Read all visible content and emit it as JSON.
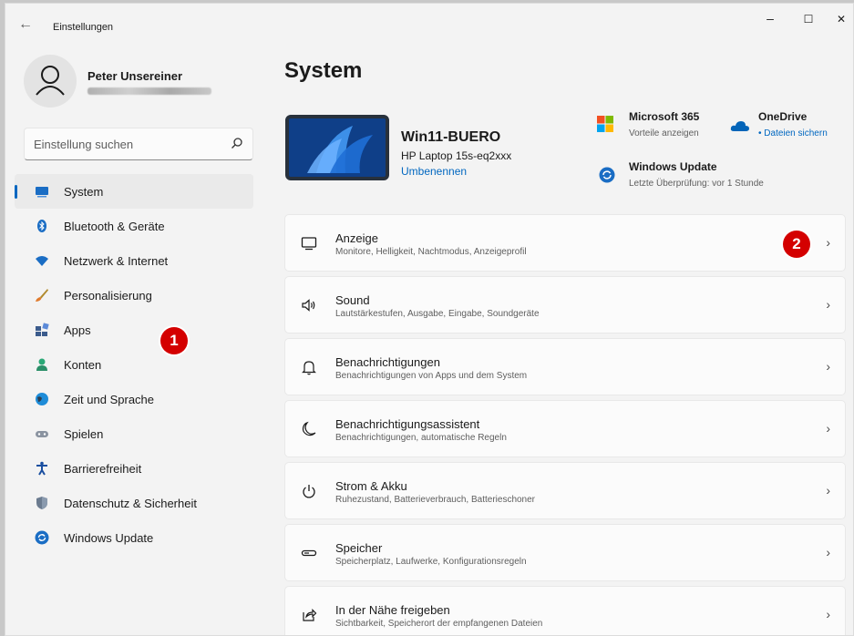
{
  "window": {
    "title": "Einstellungen",
    "back": "←",
    "minimize": "–",
    "maximize": "☐",
    "close": "✕"
  },
  "user": {
    "name": "Peter Unsereiner"
  },
  "search": {
    "placeholder": "Einstellung suchen"
  },
  "nav": [
    {
      "label": "System",
      "icon": "system-icon",
      "active": true
    },
    {
      "label": "Bluetooth & Geräte",
      "icon": "bluetooth-icon"
    },
    {
      "label": "Netzwerk & Internet",
      "icon": "network-icon"
    },
    {
      "label": "Personalisierung",
      "icon": "brush-icon"
    },
    {
      "label": "Apps",
      "icon": "apps-icon"
    },
    {
      "label": "Konten",
      "icon": "account-icon"
    },
    {
      "label": "Zeit und Sprache",
      "icon": "globe-icon"
    },
    {
      "label": "Spielen",
      "icon": "gamepad-icon"
    },
    {
      "label": "Barrierefreiheit",
      "icon": "accessibility-icon"
    },
    {
      "label": "Datenschutz & Sicherheit",
      "icon": "shield-icon"
    },
    {
      "label": "Windows Update",
      "icon": "update-icon"
    }
  ],
  "badges": {
    "one": "1",
    "two": "2"
  },
  "main": {
    "title": "System",
    "device": {
      "name": "Win11-BUERO",
      "model": "HP Laptop 15s-eq2xxx",
      "rename": "Umbenennen"
    },
    "quick": {
      "m365": {
        "title": "Microsoft 365",
        "sub": "Vorteile anzeigen"
      },
      "onedrive": {
        "title": "OneDrive",
        "sub": "• Dateien sichern"
      },
      "update": {
        "title": "Windows Update",
        "sub": "Letzte Überprüfung: vor 1 Stunde"
      }
    },
    "cards": [
      {
        "title": "Anzeige",
        "sub": "Monitore, Helligkeit, Nachtmodus, Anzeigeprofil",
        "icon": "monitor-icon"
      },
      {
        "title": "Sound",
        "sub": "Lautstärkestufen, Ausgabe, Eingabe, Soundgeräte",
        "icon": "speaker-icon"
      },
      {
        "title": "Benachrichtigungen",
        "sub": "Benachrichtigungen von Apps und dem System",
        "icon": "bell-icon"
      },
      {
        "title": "Benachrichtigungsassistent",
        "sub": "Benachrichtigungen, automatische Regeln",
        "icon": "moon-icon"
      },
      {
        "title": "Strom & Akku",
        "sub": "Ruhezustand, Batterieverbrauch, Batterieschoner",
        "icon": "power-icon"
      },
      {
        "title": "Speicher",
        "sub": "Speicherplatz, Laufwerke, Konfigurationsregeln",
        "icon": "storage-icon"
      },
      {
        "title": "In der Nähe freigeben",
        "sub": "Sichtbarkeit, Speicherort der empfangenen Dateien",
        "icon": "share-icon"
      }
    ],
    "chevron": "›"
  },
  "colors": {
    "accent": "#0067c0",
    "badge": "#d40000",
    "background": "#f3f3f3"
  }
}
